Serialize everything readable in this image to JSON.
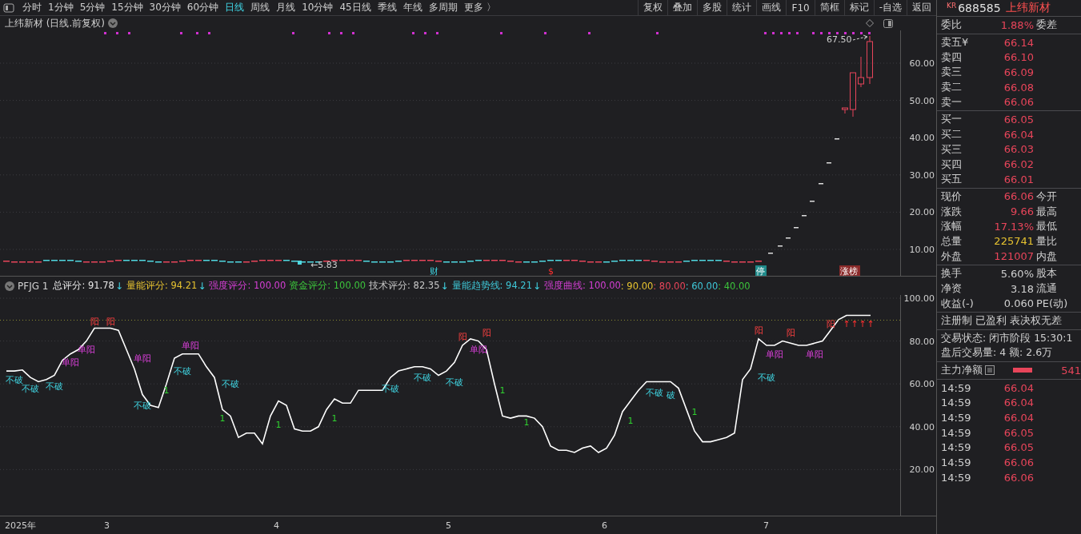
{
  "toolbar": {
    "tabs": [
      {
        "label": "分时",
        "selected": false
      },
      {
        "label": "1分钟",
        "selected": false
      },
      {
        "label": "5分钟",
        "selected": false
      },
      {
        "label": "15分钟",
        "selected": false
      },
      {
        "label": "30分钟",
        "selected": false
      },
      {
        "label": "60分钟",
        "selected": false
      },
      {
        "label": "日线",
        "selected": true
      },
      {
        "label": "周线",
        "selected": false
      },
      {
        "label": "月线",
        "selected": false
      },
      {
        "label": "10分钟",
        "selected": false
      },
      {
        "label": "45日线",
        "selected": false
      },
      {
        "label": "季线",
        "selected": false
      },
      {
        "label": "年线",
        "selected": false
      },
      {
        "label": "多周期",
        "selected": false
      },
      {
        "label": "更多 〉",
        "selected": false
      }
    ],
    "buttons": [
      "复权",
      "叠加",
      "多股",
      "统计",
      "画线",
      "F10",
      "简框",
      "标记",
      "-自选",
      "返回"
    ]
  },
  "price_chart": {
    "title": "上纬新材 (日线.前复权)",
    "y_labels": [
      "60.00",
      "50.00",
      "40.00",
      "30.00",
      "20.00",
      "10.00"
    ],
    "high_label": "67.50",
    "low_label": "←5.83",
    "events": [
      {
        "text": "财",
        "kind": "finance"
      },
      {
        "text": "$",
        "kind": "dividend"
      },
      {
        "text": "停",
        "kind": "halt"
      },
      {
        "text": "涨榜",
        "kind": "list"
      }
    ]
  },
  "indicator": {
    "readouts": [
      {
        "text": "总评分: 91.78",
        "color": "#e6e6e6",
        "arrow": "↓"
      },
      {
        "text": "量能评分: 94.21",
        "color": "#e6c230",
        "arrow": "↓"
      },
      {
        "text": "强度评分: 100.00",
        "color": "#d63fd6"
      },
      {
        "text": "资金评分: 100.00",
        "color": "#3cc43c"
      },
      {
        "text": "技术评分: 82.35",
        "color": "#c8c8c8",
        "arrow": "↓"
      },
      {
        "text": "量能趋势线: 94.21",
        "color": "#3fc8d8",
        "arrow": "↓"
      },
      {
        "text": "强度曲线: 100.00",
        "color": "#d63fd6"
      },
      {
        "text": ": 90.00",
        "color": "#e6c230"
      },
      {
        "text": ": 80.00",
        "color": "#e8455a"
      },
      {
        "text": ": 60.00",
        "color": "#3fc8d8"
      },
      {
        "text": ": 40.00",
        "color": "#3cc43c"
      }
    ],
    "chart_data": {
      "type": "line",
      "ylim": [
        -1.5,
        101.5
      ],
      "yticks": [
        {
          "value": 20,
          "label": "20.00"
        },
        {
          "value": 40,
          "label": "40.00"
        },
        {
          "value": 60,
          "label": "60.00"
        },
        {
          "value": 80,
          "label": "80.00"
        },
        {
          "value": 100,
          "label": "100.00"
        }
      ],
      "series": [
        {
          "name": "PFJG 1",
          "color": "#ffffff",
          "values": [
            66,
            66,
            66.5,
            63,
            61,
            62,
            64,
            71,
            74,
            76,
            80,
            86,
            86,
            86,
            85,
            76,
            67,
            55,
            50,
            49,
            60,
            72,
            74,
            74,
            74,
            68,
            63,
            48,
            45,
            35,
            37,
            37,
            32,
            45,
            52,
            50,
            39,
            38,
            38,
            40,
            48,
            53,
            51,
            51,
            57,
            57,
            57,
            57,
            63,
            66,
            67,
            68,
            68,
            67,
            64,
            66,
            70,
            78,
            81,
            80,
            76,
            60,
            45,
            44,
            45,
            45,
            44,
            40,
            31,
            29,
            29,
            28,
            30,
            31,
            28,
            30,
            36,
            47,
            52,
            57,
            61,
            61,
            61,
            61,
            58,
            48,
            38,
            33,
            33,
            34,
            35,
            37,
            62,
            67,
            81,
            78,
            78,
            80,
            79,
            78,
            78,
            79,
            80,
            85,
            90,
            92,
            92,
            92,
            92
          ]
        }
      ],
      "grid": true
    },
    "signals": [
      {
        "text": "不破",
        "kind": "hold"
      },
      {
        "text": "不破",
        "kind": "hold"
      },
      {
        "text": "不破",
        "kind": "hold"
      },
      {
        "text": "单阳",
        "kind": "single"
      },
      {
        "text": "单阳",
        "kind": "single"
      },
      {
        "text": "阳",
        "kind": "yang"
      },
      {
        "text": "阳",
        "kind": "yang"
      },
      {
        "text": "单阳",
        "kind": "single"
      },
      {
        "text": "不破",
        "kind": "hold"
      },
      {
        "text": "1",
        "kind": "count"
      },
      {
        "text": "不破",
        "kind": "hold"
      },
      {
        "text": "单阳",
        "kind": "single"
      },
      {
        "text": "不破",
        "kind": "hold"
      },
      {
        "text": "1",
        "kind": "count"
      },
      {
        "text": "1",
        "kind": "count"
      },
      {
        "text": "1",
        "kind": "count"
      },
      {
        "text": "不破",
        "kind": "hold"
      },
      {
        "text": "不破",
        "kind": "hold"
      },
      {
        "text": "不破",
        "kind": "hold"
      },
      {
        "text": "阳",
        "kind": "yang"
      },
      {
        "text": "单阳",
        "kind": "single"
      },
      {
        "text": "阳",
        "kind": "yang"
      },
      {
        "text": "1",
        "kind": "count"
      },
      {
        "text": "1",
        "kind": "count"
      },
      {
        "text": "1",
        "kind": "count"
      },
      {
        "text": "不破",
        "kind": "hold"
      },
      {
        "text": "破",
        "kind": "hold"
      },
      {
        "text": "1",
        "kind": "count"
      },
      {
        "text": "不破",
        "kind": "hold"
      },
      {
        "text": "阳",
        "kind": "yang"
      },
      {
        "text": "单阳",
        "kind": "single"
      },
      {
        "text": "阳",
        "kind": "yang"
      },
      {
        "text": "单阳",
        "kind": "single"
      },
      {
        "text": "阳",
        "kind": "yang"
      },
      {
        "text": "↑",
        "kind": "arrow"
      },
      {
        "text": "↑",
        "kind": "arrow"
      },
      {
        "text": "↑",
        "kind": "arrow"
      },
      {
        "text": "↑",
        "kind": "arrow"
      }
    ]
  },
  "time_axis": [
    "2025年",
    "3",
    "4",
    "5",
    "6",
    "7"
  ],
  "quote": {
    "market": "KR",
    "code": "688585",
    "name": "上纬新材",
    "ratio": {
      "label": "委比",
      "value": "1.88%",
      "label2": "委差"
    },
    "asks": [
      {
        "label": "卖五",
        "currency": "¥",
        "price": "66.14"
      },
      {
        "label": "卖四",
        "price": "66.10"
      },
      {
        "label": "卖三",
        "price": "66.09"
      },
      {
        "label": "卖二",
        "price": "66.08"
      },
      {
        "label": "卖一",
        "price": "66.06"
      }
    ],
    "bids": [
      {
        "label": "买一",
        "price": "66.05"
      },
      {
        "label": "买二",
        "price": "66.04"
      },
      {
        "label": "买三",
        "price": "66.03"
      },
      {
        "label": "买四",
        "price": "66.02"
      },
      {
        "label": "买五",
        "price": "66.01"
      }
    ],
    "stats": [
      {
        "label": "现价",
        "value": "66.06",
        "color": "#e8455a",
        "label2": "今开"
      },
      {
        "label": "涨跌",
        "value": "9.66",
        "color": "#e8455a",
        "label2": "最高"
      },
      {
        "label": "涨幅",
        "value": "17.13%",
        "color": "#e8455a",
        "label2": "最低"
      },
      {
        "label": "总量",
        "value": "225741",
        "color": "#e6c230",
        "label2": "量比"
      },
      {
        "label": "外盘",
        "value": "121007",
        "color": "#e8455a",
        "label2": "内盘"
      }
    ],
    "stats2": [
      {
        "label": "换手",
        "value": "5.60%",
        "label2": "股本"
      },
      {
        "label": "净资",
        "value": "3.18",
        "label2": "流通"
      },
      {
        "label": "收益(-)",
        "value": "0.060",
        "label2": "PE(动)"
      }
    ],
    "tags": "注册制 已盈利 表决权无差",
    "status_lines": [
      "交易状态: 闭市阶段 15:30:1",
      "盘后交易量: 4  额: 2.6万"
    ],
    "main_flow": {
      "label": "主力净额",
      "value": "541"
    },
    "ticks": [
      {
        "time": "14:59",
        "price": "66.04"
      },
      {
        "time": "14:59",
        "price": "66.04"
      },
      {
        "time": "14:59",
        "price": "66.04"
      },
      {
        "time": "14:59",
        "price": "66.05"
      },
      {
        "time": "14:59",
        "price": "66.05"
      },
      {
        "time": "14:59",
        "price": "66.06"
      },
      {
        "time": "14:59",
        "price": "66.06"
      }
    ]
  }
}
